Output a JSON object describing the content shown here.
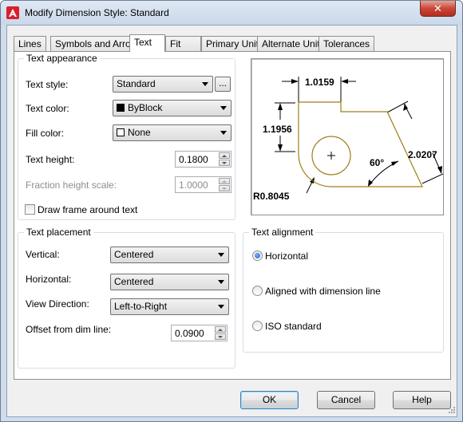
{
  "window": {
    "title": "Modify Dimension Style: Standard",
    "close_glyph": "✕"
  },
  "tabs": [
    {
      "label": "Lines"
    },
    {
      "label": "Symbols and Arrows"
    },
    {
      "label": "Text"
    },
    {
      "label": "Fit"
    },
    {
      "label": "Primary Units"
    },
    {
      "label": "Alternate Units"
    },
    {
      "label": "Tolerances"
    }
  ],
  "text_appearance": {
    "legend": "Text appearance",
    "text_style_label": "Text style:",
    "text_style_value": "Standard",
    "browse_button": "...",
    "text_color_label": "Text color:",
    "text_color_value": "ByBlock",
    "text_color_swatch": "#000000",
    "fill_color_label": "Fill color:",
    "fill_color_value": "None",
    "fill_color_swatch": "#ffffff",
    "text_height_label": "Text height:",
    "text_height_value": "0.1800",
    "fraction_label": "Fraction height scale:",
    "fraction_value": "1.0000",
    "frame_label": "Draw frame around text",
    "frame_checked": false
  },
  "preview": {
    "dim_top": "1.0159",
    "dim_left": "1.1956",
    "dim_right": "2.0207",
    "dim_angle": "60°",
    "dim_radius": "R0.8045",
    "outline_color": "#a07d16"
  },
  "text_placement": {
    "legend": "Text placement",
    "vertical_label": "Vertical:",
    "vertical_value": "Centered",
    "horizontal_label": "Horizontal:",
    "horizontal_value": "Centered",
    "view_direction_label": "View Direction:",
    "view_direction_value": "Left-to-Right",
    "offset_label": "Offset from dim line:",
    "offset_value": "0.0900"
  },
  "text_alignment": {
    "legend": "Text alignment",
    "options": [
      {
        "label": "Horizontal",
        "selected": true
      },
      {
        "label": "Aligned with dimension line",
        "selected": false
      },
      {
        "label": "ISO standard",
        "selected": false
      }
    ]
  },
  "buttons": {
    "ok": "OK",
    "cancel": "Cancel",
    "help": "Help"
  }
}
